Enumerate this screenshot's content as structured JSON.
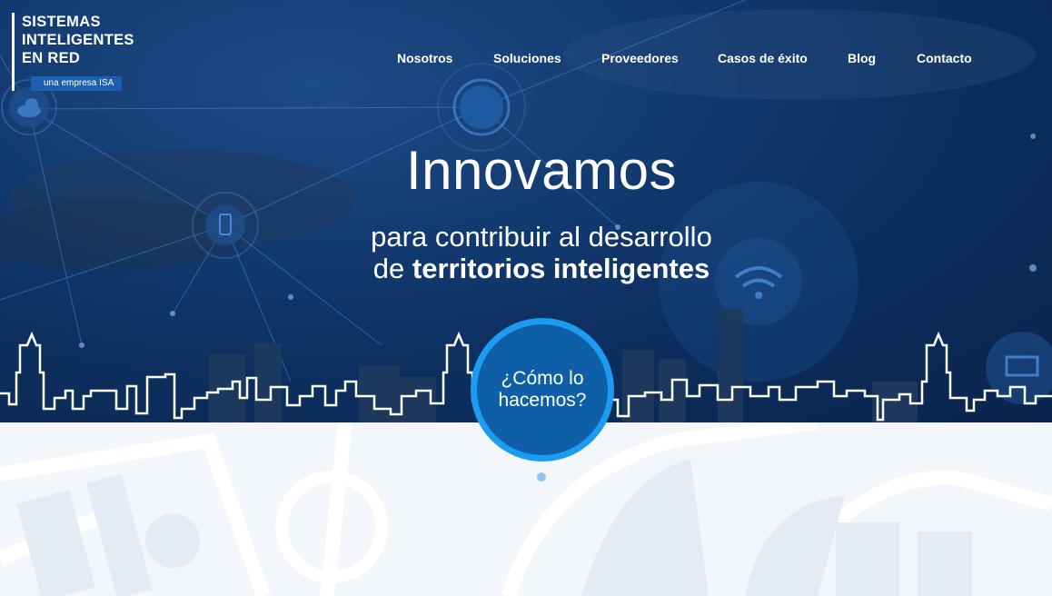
{
  "logo": {
    "line1": "SISTEMAS",
    "line2": "INTELIGENTES",
    "line3": "EN RED",
    "tagline": "una empresa ISA"
  },
  "nav": {
    "items": [
      "Nosotros",
      "Soluciones",
      "Proveedores",
      "Casos de éxito",
      "Blog",
      "Contacto"
    ]
  },
  "hero": {
    "headline": "Innovamos",
    "subtitle_line1": "para contribuir al desarrollo",
    "subtitle_line2_prefix": "de ",
    "subtitle_line2_bold": "territorios inteligentes"
  },
  "cta": {
    "label_line1": "¿Cómo lo",
    "label_line2": "hacemos?"
  },
  "colors": {
    "hero_dark": "#0c2d5c",
    "accent_blue": "#1c9cf0",
    "cta_inner": "#0f5ea8",
    "lower_bg": "#f3f6fb"
  },
  "icons": [
    "cloud-icon",
    "phone-icon",
    "wifi-icon",
    "laptop-icon"
  ]
}
